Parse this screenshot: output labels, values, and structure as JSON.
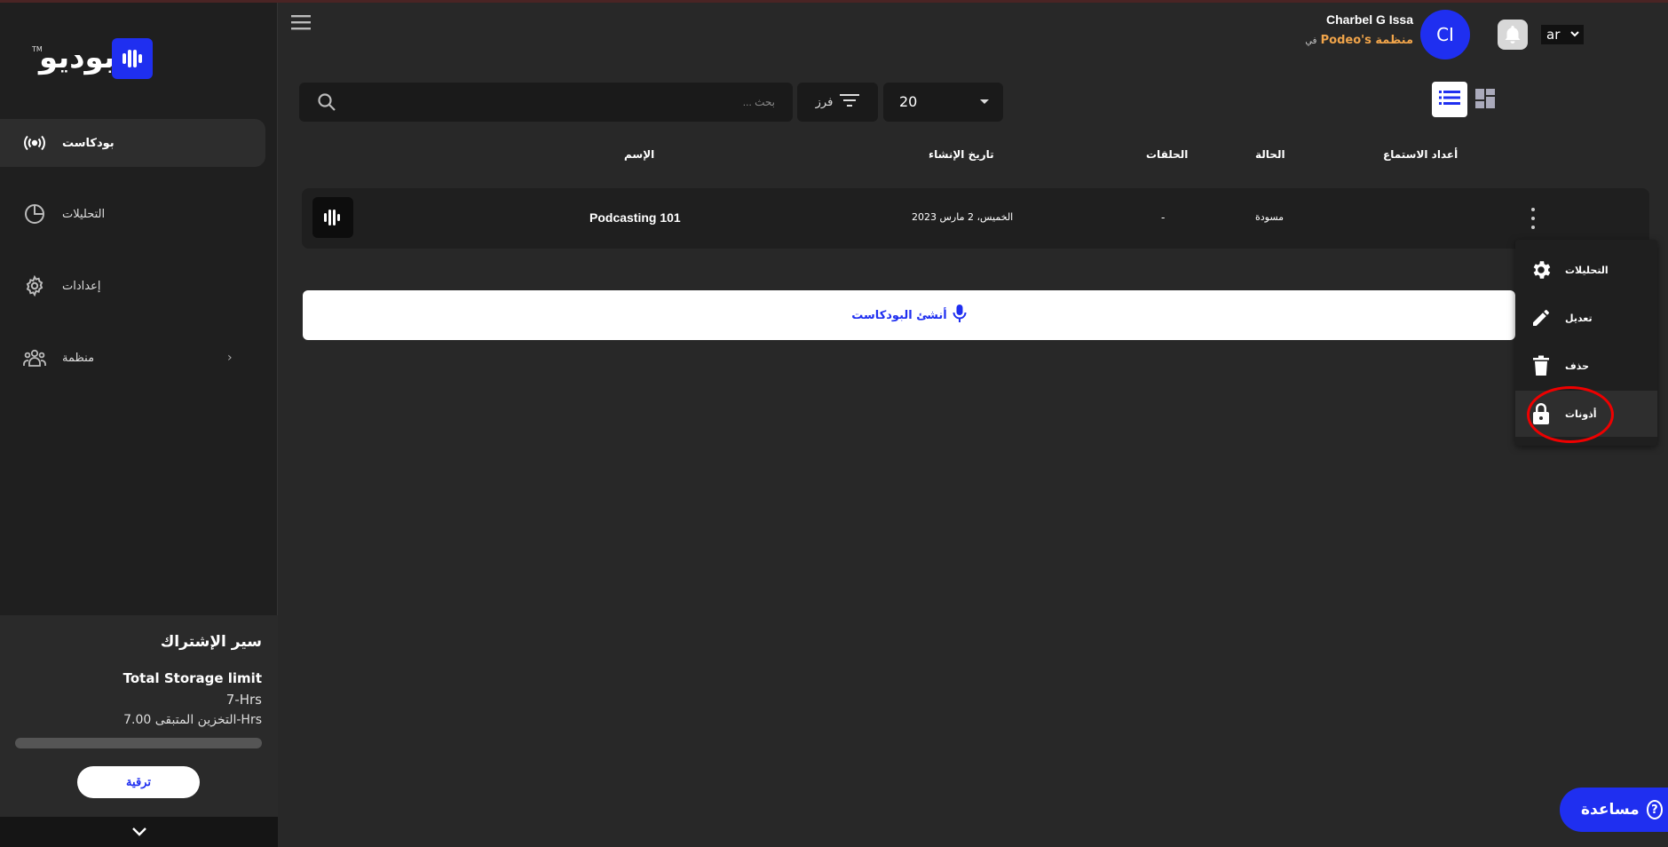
{
  "brand": {
    "logo_text": "بوديو",
    "logo_tm": "TM"
  },
  "sidebar": {
    "items": [
      {
        "label": "بودكاست",
        "icon": "broadcast-icon",
        "active": true
      },
      {
        "label": "التحليلات",
        "icon": "pie-chart-icon",
        "active": false
      },
      {
        "label": "إعدادات",
        "icon": "gear-icon",
        "active": false
      },
      {
        "label": "منظمة",
        "icon": "people-icon",
        "active": false
      }
    ],
    "subscription": {
      "title": "سير الإشتراك",
      "storage_label": "Total Storage limit",
      "hours": "7-Hrs",
      "remaining": "التخزين المتبقى 7.00-Hrs",
      "used_fraction": 0,
      "upgrade_label": "ترقية"
    }
  },
  "header": {
    "user_name": "Charbel G Issa",
    "org_name": "منظمة Podeo's",
    "org_prefix": "في",
    "avatar_initials": "CI",
    "language": "ar"
  },
  "toolbar": {
    "search_placeholder": "بحث ...",
    "sort_label": "فرز",
    "page_size": "20"
  },
  "table": {
    "headers": {
      "name": "الإسم",
      "created": "تاريخ الإنشاء",
      "episodes": "الحلقات",
      "status": "الحالة",
      "listens": "أعداد الاستماع"
    },
    "rows": [
      {
        "name": "Podcasting 101",
        "created": "الخميس، 2 مارس 2023",
        "episodes": "-",
        "status": "مسودة",
        "listens": ""
      }
    ]
  },
  "create_button_label": "أنشئ البودكاست",
  "context_menu": {
    "items": [
      {
        "label": "التحليلات",
        "icon": "gear-icon"
      },
      {
        "label": "تعديل",
        "icon": "pencil-icon"
      },
      {
        "label": "حذف",
        "icon": "trash-icon"
      },
      {
        "label": "أذونات",
        "icon": "lock-icon"
      }
    ]
  },
  "help_label": "مساعدة",
  "colors": {
    "accent": "#1f2ff0",
    "org_link": "#f0a44a",
    "highlight_circle": "#e00000"
  }
}
